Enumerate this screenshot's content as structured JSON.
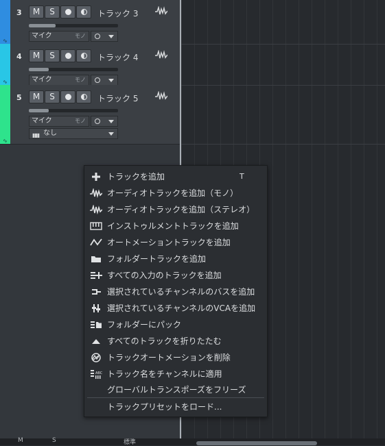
{
  "tracks": [
    {
      "number": "3",
      "name": "トラック 3",
      "color": "#2f8de0",
      "mute": "M",
      "solo": "S",
      "input": "マイク",
      "mode": "モノ",
      "fader": 0.3
    },
    {
      "number": "4",
      "name": "トラック 4",
      "color": "#29c6e6",
      "mute": "M",
      "solo": "S",
      "input": "マイク",
      "mode": "モノ",
      "fader": 0.22
    },
    {
      "number": "5",
      "name": "トラック 5",
      "color": "#2ee38c",
      "mute": "M",
      "solo": "S",
      "input": "マイク",
      "mode": "モノ",
      "fader": 0.22,
      "output": "なし"
    }
  ],
  "menu": {
    "items": [
      {
        "label": "トラックを追加",
        "icon": "plus-icon",
        "shortcut": "T"
      },
      {
        "label": "オーディオトラックを追加（モノ）",
        "icon": "audio-wave-icon"
      },
      {
        "label": "オーディオトラックを追加（ステレオ）",
        "icon": "audio-wave-icon"
      },
      {
        "label": "インストゥルメントトラックを追加",
        "icon": "keyboard-icon"
      },
      {
        "label": "オートメーショントラックを追加",
        "icon": "automation-curve-icon"
      },
      {
        "label": "フォルダートラックを追加",
        "icon": "folder-icon"
      },
      {
        "label": "すべての入力のトラックを追加",
        "icon": "list-add-icon"
      },
      {
        "label": "選択されているチャンネルのバスを追加",
        "icon": "bus-icon"
      },
      {
        "label": "選択されているチャンネルのVCAを追加",
        "icon": "vca-icon"
      },
      {
        "label": "フォルダーにパック",
        "icon": "pack-folder-icon"
      },
      {
        "label": "すべてのトラックを折りたたむ",
        "icon": "collapse-triangle-icon"
      },
      {
        "label": "トラックオートメーションを削除",
        "icon": "remove-automation-icon"
      },
      {
        "label": "トラック名をチャンネルに適用",
        "icon": "apply-name-icon"
      },
      {
        "label": "グローバルトランスポーズをフリーズ",
        "icon": ""
      },
      {
        "label": "トラックプリセットをロード...",
        "icon": ""
      }
    ]
  },
  "bottom": {
    "m": "M",
    "s": "S",
    "std": "標準"
  }
}
